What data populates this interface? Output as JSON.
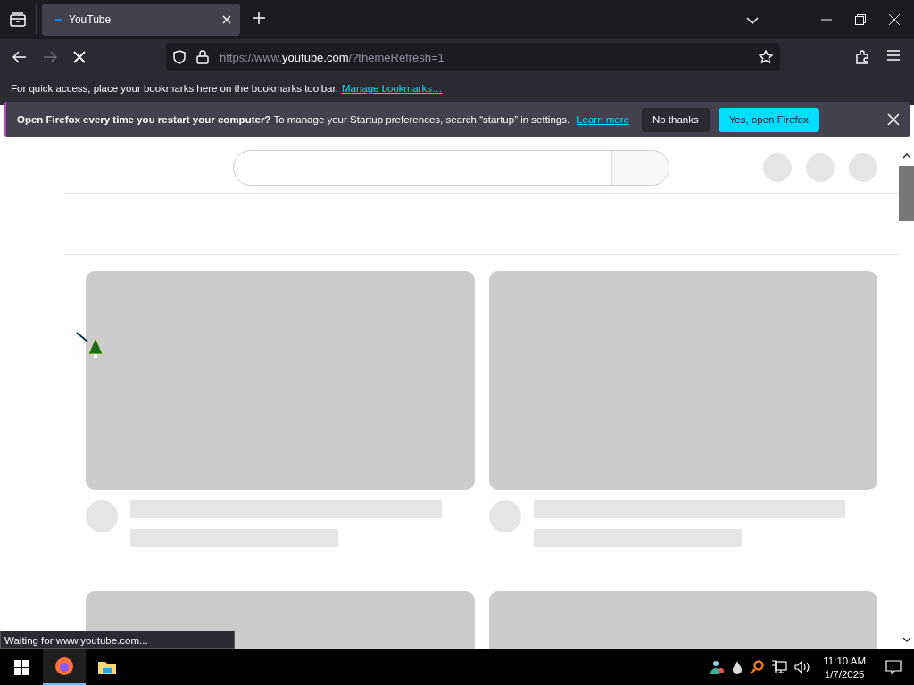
{
  "tabs": [
    {
      "title": "YouTube",
      "selected": true
    }
  ],
  "toolbar": {
    "url": {
      "prefix": "https://www.",
      "host": "youtube.com",
      "path": "/?themeRefresh=1"
    },
    "forward_disabled": true
  },
  "bookmarks_bar": {
    "text": "For quick access, place your bookmarks here on the bookmarks toolbar.",
    "link": "Manage bookmarks…"
  },
  "notification": {
    "message": "**Open Firefox every time you restart your computer?** To manage your Startup preferences, search “startup” in settings.",
    "link": "Learn more",
    "buttons": [
      {
        "label": "No thanks",
        "kind": "secondary"
      },
      {
        "label": "Yes, open Firefox",
        "kind": "primary"
      }
    ]
  },
  "page": {
    "cards": [
      {
        "kind": "skeleton"
      },
      {
        "kind": "skeleton"
      },
      {
        "kind": "thumbnail"
      },
      {
        "kind": "thumbnail"
      }
    ]
  },
  "status": "Waiting for www.youtube.com...",
  "taskbar": {
    "apps": [
      {
        "kind": "firefox",
        "selected": true
      },
      {
        "kind": "explorer",
        "selected": false
      }
    ],
    "time": "11:10 AM",
    "date": "1/7/2025"
  }
}
